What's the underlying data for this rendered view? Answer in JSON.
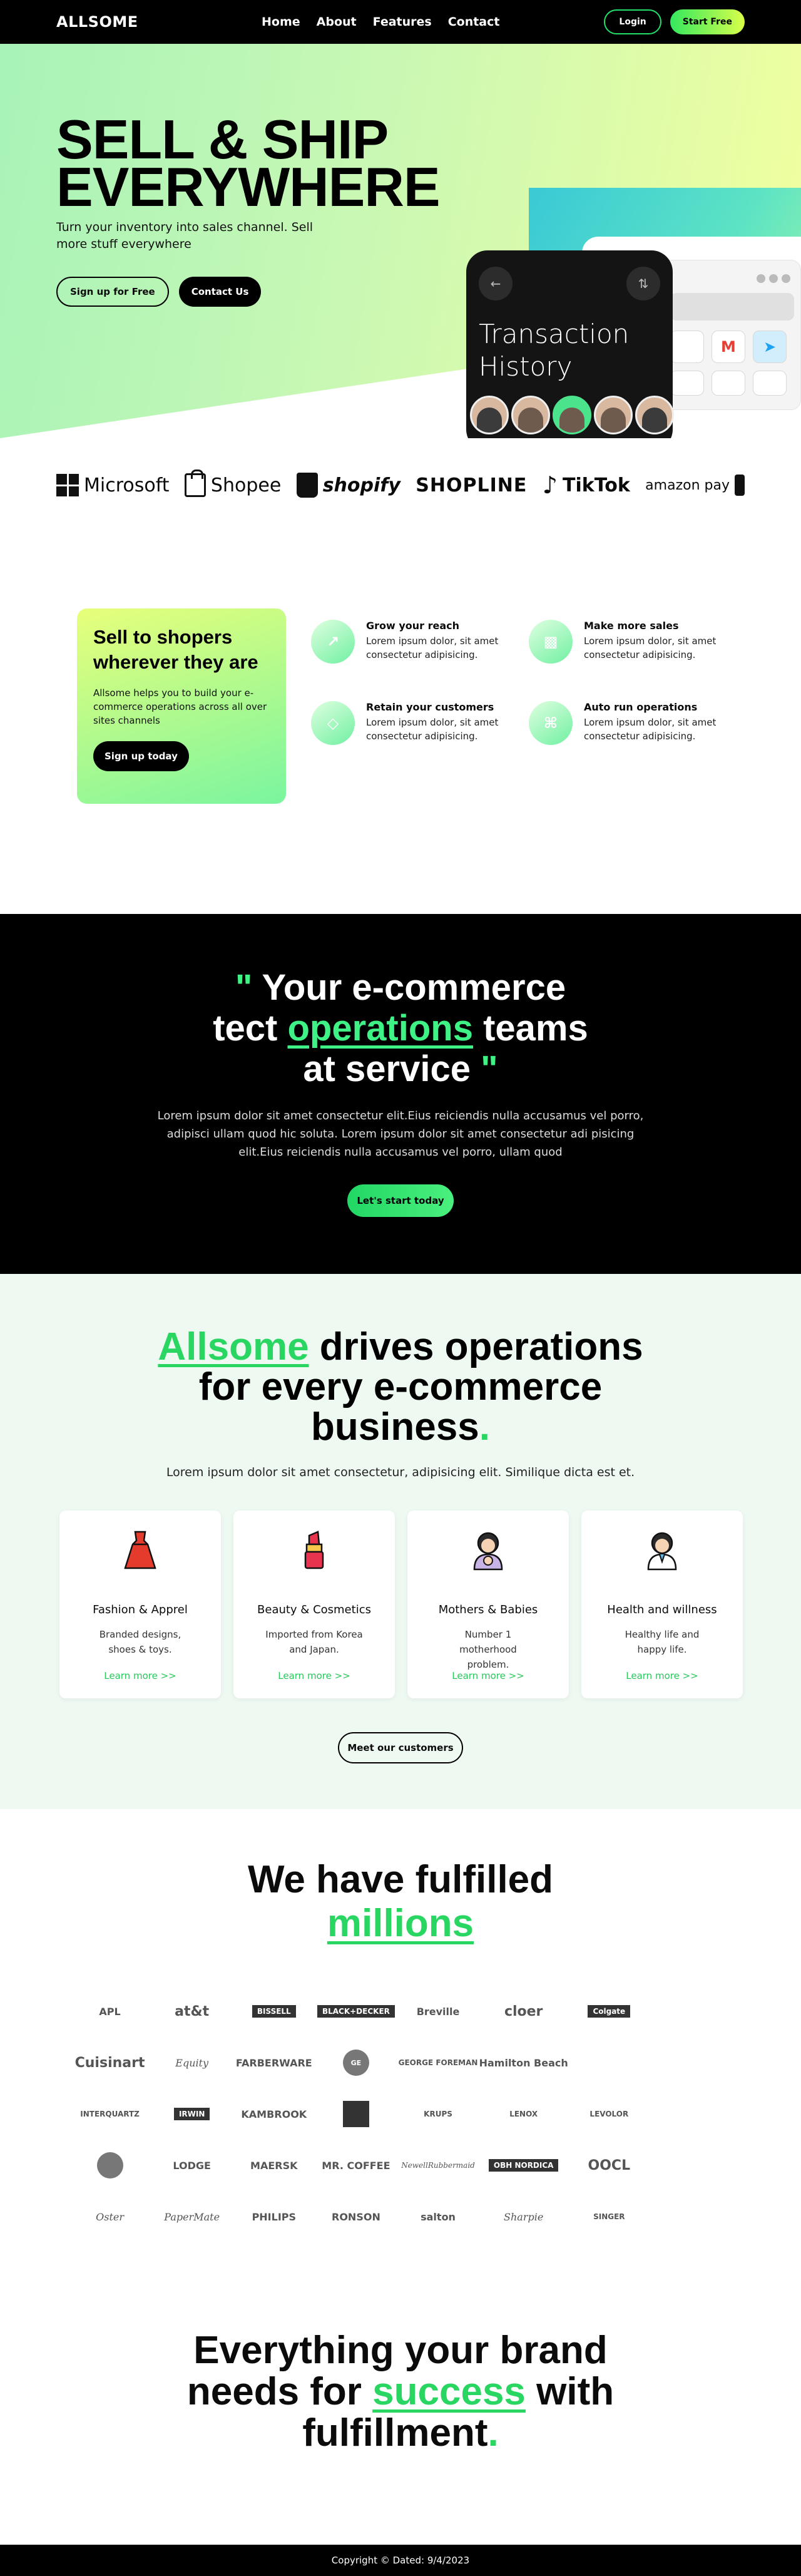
{
  "nav": {
    "logo": "ALLSOME",
    "links": [
      "Home",
      "About",
      "Features",
      "Contact"
    ],
    "login": "Login",
    "start_free": "Start Free"
  },
  "hero": {
    "title_line1": "SELL & SHIP",
    "title_line2": "EVERYWHERE",
    "subtitle": "Turn your inventory into sales channel. Sell more stuff everywhere",
    "signup_button": "Sign up for Free",
    "contact_button": "Contact Us",
    "phone_title_line1": "Transaction",
    "phone_title_line2": "History"
  },
  "partners": [
    "Microsoft",
    "Shopee",
    "shopify",
    "SHOPLINE",
    "TikTok",
    "amazon pay"
  ],
  "features": {
    "card_title": "Sell to shopers wherever they are",
    "card_text": "Allsome helps you to build your e-commerce operations across all over sites channels",
    "card_button": "Sign up today",
    "items": [
      {
        "title": "Grow your reach",
        "text": "Lorem ipsum dolor, sit amet consectetur adipisicing.",
        "icon": "chart-icon"
      },
      {
        "title": "Make more sales",
        "text": "Lorem ipsum dolor, sit amet consectetur adipisicing.",
        "icon": "bar-chart-icon"
      },
      {
        "title": "Retain your customers",
        "text": "Lorem ipsum dolor, sit amet consectetur adipisicing.",
        "icon": "tag-icon"
      },
      {
        "title": "Auto run operations",
        "text": "Lorem ipsum dolor, sit amet consectetur adipisicing.",
        "icon": "command-icon"
      }
    ]
  },
  "service": {
    "open_quote": "\"",
    "line1": "Your e-commerce",
    "line2_pre": "tect ",
    "line2_highlight": "operations",
    "line2_post": " teams",
    "line3": "at service",
    "close_quote": "\"",
    "text": "Lorem ipsum dolor sit amet consectetur elit.Eius reiciendis nulla accusamus vel porro, adipisci ullam quod hic soluta. Lorem ipsum dolor sit amet consectetur adi pisicing elit.Eius reiciendis nulla accusamus vel porro, ullam quod",
    "cta": "Let's start today"
  },
  "categories": {
    "heading_highlight": "Allsome",
    "heading_rest_line1": " drives operations",
    "heading_line2": "for every e-commerce",
    "heading_line3": "business",
    "heading_dot": ".",
    "subtitle": "Lorem ipsum dolor sit amet consectetur, adipisicing elit. Similique dicta est et.",
    "items": [
      {
        "title": "Fashion & Apprel",
        "text": "Branded designs, shoes & toys.",
        "link": "Learn more >>"
      },
      {
        "title": "Beauty & Cosmetics",
        "text": "Imported from Korea and Japan.",
        "link": "Learn more >>"
      },
      {
        "title": "Mothers & Babies",
        "text": "Number 1 motherhood problem.",
        "link": "Learn more >>"
      },
      {
        "title": "Health and willness",
        "text": "Healthy life and happy life.",
        "link": "Learn more >>"
      }
    ],
    "meet_button": "Meet our customers"
  },
  "millions": {
    "line1": "We have fulfilled",
    "highlight": "millions",
    "brands": [
      "APL",
      "at&t",
      "BISSELL",
      "BLACK+DECKER",
      "Breville",
      "cloer",
      "Colgate",
      "",
      "Cuisinart",
      "Equity",
      "FARBERWARE",
      "GE",
      "GEORGE FOREMAN",
      "Hamilton Beach",
      "",
      "",
      "INTERQUARTZ",
      "IRWIN",
      "KAMBROOK",
      "",
      "KRUPS",
      "LENOX",
      "LEVOLOR",
      "",
      "",
      "LODGE",
      "MAERSK",
      "MR. COFFEE",
      "NewellRubbermaid",
      "OBH NORDICA",
      "OOCL",
      "",
      "Oster",
      "PaperMate",
      "PHILIPS",
      "RONSON",
      "salton",
      "Sharpie",
      "SINGER",
      "",
      "",
      "",
      "",
      "",
      "",
      "",
      "",
      ""
    ]
  },
  "final": {
    "line1": "Everything your brand",
    "line2_pre": "needs for ",
    "line2_highlight": "success",
    "line2_post": " with",
    "line3": "fulfillment",
    "dot": "."
  },
  "footer": {
    "text": "Copyright © Dated: 9/4/2023"
  },
  "colors": {
    "accent": "#2ad662",
    "black": "#000000"
  }
}
